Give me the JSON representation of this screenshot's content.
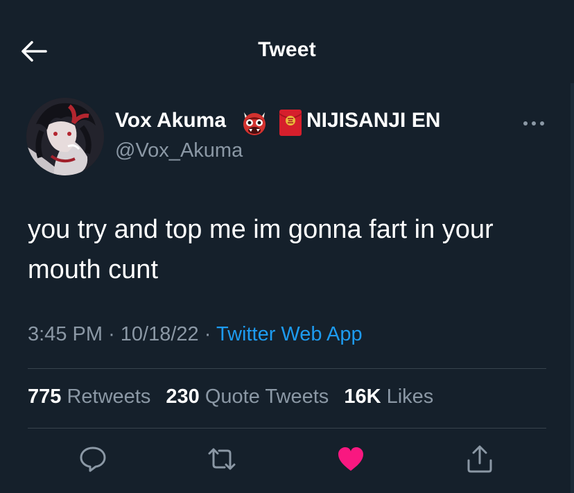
{
  "header": {
    "title": "Tweet",
    "back_icon": "arrow-left-icon"
  },
  "tweet": {
    "author": {
      "display_name": "Vox Akuma",
      "badges": [
        "ogre-emoji-icon",
        "red-envelope-emoji-icon"
      ],
      "org": "NIJISANJI EN",
      "handle": "@Vox_Akuma"
    },
    "text": "you try and top me im gonna fart in your mouth cunt",
    "time": "3:45 PM",
    "date": "10/18/22",
    "separator": "·",
    "source": "Twitter Web App"
  },
  "stats": {
    "retweets_count": "775",
    "retweets_label": "Retweets",
    "quotes_count": "230",
    "quotes_label": "Quote Tweets",
    "likes_count": "16K",
    "likes_label": "Likes"
  },
  "actions": [
    "reply-icon",
    "retweet-icon",
    "like-icon",
    "share-icon"
  ],
  "colors": {
    "background": "#15202b",
    "text_primary": "#ffffff",
    "text_secondary": "#8b98a5",
    "link": "#1d9bf0",
    "like_active": "#f91880",
    "divider": "#38444d"
  }
}
